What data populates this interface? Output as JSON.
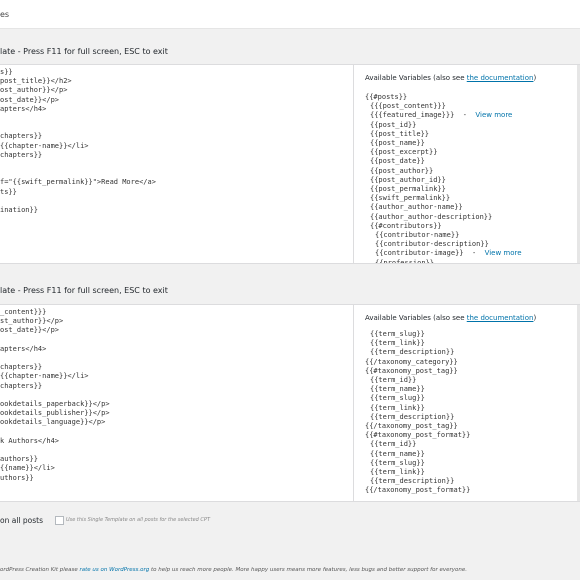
{
  "header": {
    "title": "es"
  },
  "section1": {
    "title": "late - Press F11 for full screen, ESC to exit",
    "code": [
      "s}}",
      "post_title}}</h2>",
      "ost_author}}</p>",
      "ost_date}}</p>",
      "apters</h4>",
      "",
      "",
      "chapters}}",
      "{{chapter-name}}</li>",
      "chapters}}",
      "",
      "",
      "f=\"{{swift_permalink}}\">Read More</a>",
      "ts}}",
      "",
      "ination}}"
    ],
    "vars_label": "Available Variables (also see ",
    "vars_link": "the documentation",
    "vars_close": ")",
    "variables": [
      {
        "indent": 0,
        "text": "{{#posts}}"
      },
      {
        "indent": 1,
        "text": "{{{post_content}}}"
      },
      {
        "indent": 1,
        "text": "{{{featured_image}}}",
        "link": "View more"
      },
      {
        "indent": 1,
        "text": "{{post_id}}"
      },
      {
        "indent": 1,
        "text": "{{post_title}}"
      },
      {
        "indent": 1,
        "text": "{{post_name}}"
      },
      {
        "indent": 1,
        "text": "{{post_excerpt}}"
      },
      {
        "indent": 1,
        "text": "{{post_date}}"
      },
      {
        "indent": 1,
        "text": "{{post_author}}"
      },
      {
        "indent": 1,
        "text": "{{post_author_id}}"
      },
      {
        "indent": 1,
        "text": "{{post_permalink}}"
      },
      {
        "indent": 1,
        "text": "{{swift_permalink}}"
      },
      {
        "indent": 1,
        "text": "{{author_author-name}}"
      },
      {
        "indent": 1,
        "text": "{{author_author-description}}"
      },
      {
        "indent": 1,
        "text": "{{#contributors}}"
      },
      {
        "indent": 2,
        "text": "{{contributor-name}}"
      },
      {
        "indent": 2,
        "text": "{{contributor-description}}"
      },
      {
        "indent": 2,
        "text": "{{contributor-image}}",
        "link": "View more"
      },
      {
        "indent": 2,
        "text": "{{profession}}"
      }
    ]
  },
  "section2": {
    "title": "late - Press F11 for full screen, ESC to exit",
    "code": [
      "_content}}}",
      "st_author}}</p>",
      "ost_date}}</p>",
      "",
      "apters</h4>",
      "",
      "chapters}}",
      "{{chapter-name}}</li>",
      "chapters}}",
      "",
      "ookdetails_paperback}}</p>",
      "ookdetails_publisher}}</p>",
      "ookdetails_language}}</p>",
      "",
      "k Authors</h4>",
      "",
      "authors}}",
      "{{name}}</li>",
      "uthors}}"
    ],
    "vars_label": "Available Variables (also see ",
    "vars_link": "the documentation",
    "vars_close": ")",
    "variables": [
      {
        "indent": 1,
        "text": "{{term_slug}}"
      },
      {
        "indent": 1,
        "text": "{{term_link}}"
      },
      {
        "indent": 1,
        "text": "{{term_description}}"
      },
      {
        "indent": 0,
        "text": "{{/taxonomy_category}}"
      },
      {
        "indent": 0,
        "text": "{{#taxonomy_post_tag}}"
      },
      {
        "indent": 1,
        "text": "{{term_id}}"
      },
      {
        "indent": 1,
        "text": "{{term_name}}"
      },
      {
        "indent": 1,
        "text": "{{term_slug}}"
      },
      {
        "indent": 1,
        "text": "{{term_link}}"
      },
      {
        "indent": 1,
        "text": "{{term_description}}"
      },
      {
        "indent": 0,
        "text": "{{/taxonomy_post_tag}}"
      },
      {
        "indent": 0,
        "text": "{{#taxonomy_post_format}}"
      },
      {
        "indent": 1,
        "text": "{{term_id}}"
      },
      {
        "indent": 1,
        "text": "{{term_name}}"
      },
      {
        "indent": 1,
        "text": "{{term_slug}}"
      },
      {
        "indent": 1,
        "text": "{{term_link}}"
      },
      {
        "indent": 1,
        "text": "{{term_description}}"
      },
      {
        "indent": 0,
        "text": "{{/taxonomy_post_format}}"
      }
    ]
  },
  "apply": {
    "label": "on all posts",
    "hint": "Use this Single Template on all posts for the selected CPT"
  },
  "footer": {
    "text_before": "ordPress Creation Kit please ",
    "link": "rate us on WordPress.org",
    "text_after": " to help us reach more people. More happy users means more features, less bugs and better support for everyone."
  }
}
